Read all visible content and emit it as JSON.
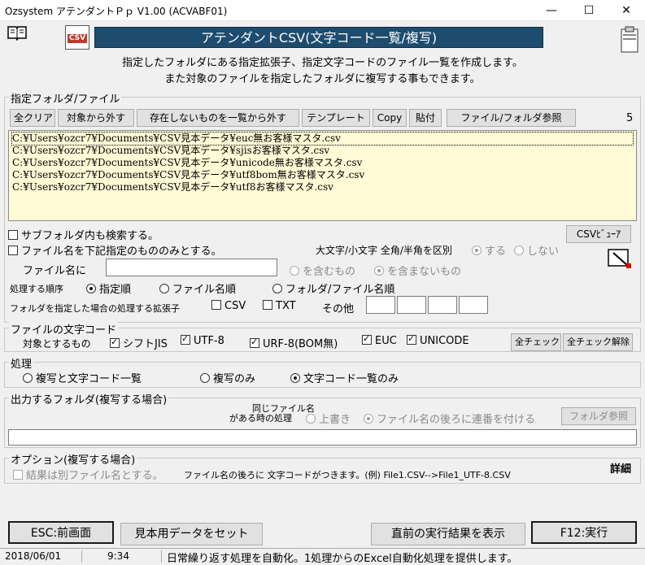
{
  "window": {
    "title": "Ozsystem アテンダントＰｐ V1.00 (ACVABF01)",
    "minimize": "—",
    "maximize": "☐",
    "close": "✕"
  },
  "banner": "アテンダントCSV(文字コード一覧/複写)",
  "csv_logo": "CSV",
  "description": [
    "指定したフォルダにある指定拡張子、指定文字コードのファイル一覧を作成します。",
    "また対象のファイルを指定したフォルダに複写する事もできます。"
  ],
  "folder_group": {
    "legend": "指定フォルダ/ファイル",
    "buttons": {
      "clear_all": "全クリア",
      "remove": "対象から外す",
      "remove_missing": "存在しないものを一覧から外す",
      "template": "テンプレート",
      "copy": "Copy",
      "paste": "貼付",
      "browse": "ファイル/フォルダ参照"
    },
    "count": "5",
    "files": [
      "C:¥Users¥ozcr7¥Documents¥CSV見本データ¥euc無お客様マスタ.csv",
      "C:¥Users¥ozcr7¥Documents¥CSV見本データ¥sjisお客様マスタ.csv",
      "C:¥Users¥ozcr7¥Documents¥CSV見本データ¥unicode無お客様マスタ.csv",
      "C:¥Users¥ozcr7¥Documents¥CSV見本データ¥utf8bom無お客様マスタ.csv",
      "C:¥Users¥ozcr7¥Documents¥CSV見本データ¥utf8お客様マスタ.csv"
    ],
    "csv_viewer": "CSVﾋﾞｭｰｱ",
    "subfolder": "サブフォルダ内も検索する。",
    "filename_only": "ファイル名を下記指定のもののみとする。",
    "case_label": "大文字/小文字 全角/半角を区別",
    "case_yes": "する",
    "case_no": "しない",
    "filename_label": "ファイル名に",
    "filename_value": "",
    "contains": "を含むもの",
    "not_contains": "を含まないもの",
    "order_label": "処理する順序",
    "order_options": [
      "指定順",
      "ファイル名順",
      "フォルダ/ファイル名順"
    ],
    "ext_label": "フォルダを指定した場合の処理する拡張子",
    "ext_csv": "CSV",
    "ext_txt": "TXT",
    "ext_other": "その他"
  },
  "encoding_group": {
    "legend": "ファイルの文字コード",
    "target_label": "対象とするもの",
    "options": [
      "シフトJIS",
      "UTF-8",
      "URF-8(BOM無)",
      "EUC",
      "UNICODE"
    ],
    "check_all": "全チェック",
    "uncheck_all": "全チェック解除"
  },
  "process_group": {
    "legend": "処理",
    "options": [
      "複写と文字コード一覧",
      "複写のみ",
      "文字コード一覧のみ"
    ]
  },
  "output_group": {
    "legend": "出力するフォルダ(複写する場合)",
    "same_name_label_1": "同じファイル名",
    "same_name_label_2": "がある時の処理",
    "overwrite": "上書き",
    "sequence": "ファイル名の後ろに連番を付ける",
    "browse": "フォルダ参照",
    "path_value": ""
  },
  "option_group": {
    "legend": "オプション(複写する場合)",
    "separate_file": "結果は別ファイル名とする。",
    "note": "ファイル名の後ろに 文字コードがつきます。(例) File1.CSV-->File1_UTF-8.CSV",
    "detail": "詳細"
  },
  "bottom_buttons": {
    "back": "ESC:前画面",
    "sample": "見本用データをセット",
    "last_result": "直前の実行結果を表示",
    "run": "F12:実行"
  },
  "status": {
    "date": "2018/06/01",
    "time": "9:34",
    "message": "日常繰り返す処理を自動化。1処理からのExcel自動化処理を提供します。"
  }
}
